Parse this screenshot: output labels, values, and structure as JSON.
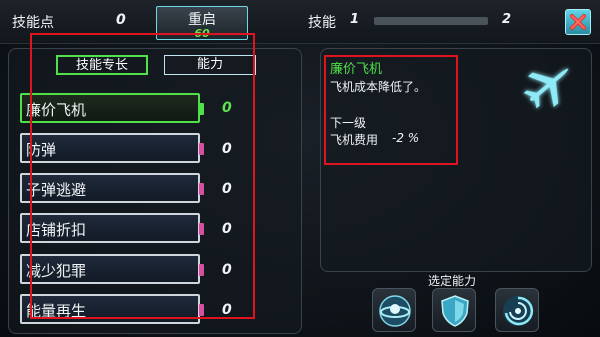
{
  "header": {
    "skill_points_label": "技能点",
    "skill_points_value": "0",
    "reset_label": "重启",
    "reset_cost": "60",
    "level_label": "技能",
    "level_current": "1",
    "level_next": "2",
    "level_progress": 0.0
  },
  "tabs": [
    {
      "label": "技能专长",
      "active": true
    },
    {
      "label": "能力",
      "active": false
    }
  ],
  "skills": [
    {
      "name": "廉价飞机",
      "level": "0",
      "selected": true
    },
    {
      "name": "防弹",
      "level": "0",
      "selected": false
    },
    {
      "name": "子弹逃避",
      "level": "0",
      "selected": false
    },
    {
      "name": "店铺折扣",
      "level": "0",
      "selected": false
    },
    {
      "name": "减少犯罪",
      "level": "0",
      "selected": false
    },
    {
      "name": "能量再生",
      "level": "0",
      "selected": false
    }
  ],
  "detail": {
    "title": "廉价飞机",
    "description": "飞机成本降低了。",
    "next_level_label": "下一级",
    "cost_label": "飞机费用",
    "cost_value": "-2 %",
    "icon": "airplane-icon"
  },
  "abilities": {
    "label": "选定能力",
    "slots": [
      "orbit-icon",
      "shield-icon",
      "vortex-icon"
    ]
  },
  "colors": {
    "accent_green": "#4fe04a",
    "accent_cyan": "#5fd5e8",
    "highlight_red": "#e0141e",
    "slot_pink": "#d94fa0"
  }
}
